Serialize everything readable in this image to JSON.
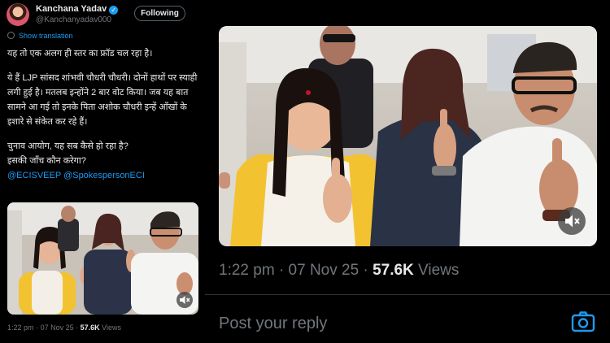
{
  "author": {
    "name": "Kanchana Yadav",
    "handle": "@Kanchanyadav000",
    "verified_icon": "verified-badge-icon",
    "follow_label": "Following"
  },
  "show_translation": "Show translation",
  "tweet": {
    "line1": "यह तो एक अलग ही स्तर का फ्रॉड चल रहा है।",
    "line2": "ये हैं LJP सांसद शांभवी चौधरी चौधरी। दोनों हाथों पर स्याही लगी हुई है। मतलब इन्होंने 2 बार वोट किया। जब यह बात सामने आ गई तो इनके पिता अशोक चौधरी इन्हें आँखों के इशारे से संकेत कर रहे हैं।",
    "line3": "चुनाव आयोग, यह सब कैसे हो रहा है?",
    "line4": "इसकी जाँच कौन करेगा?",
    "mention1": "@ECISVEEP",
    "mention2": "@SpokespersonECI"
  },
  "meta": {
    "time": "1:22 pm",
    "sep": "·",
    "date": "07 Nov 25",
    "views_count": "57.6K",
    "views_label": "Views"
  },
  "reply": {
    "placeholder": "Post your reply"
  },
  "colors": {
    "background": "#000000",
    "accent": "#1d9bf0",
    "muted": "#71767b",
    "text": "#e7e9ea"
  },
  "icons": {
    "mute": "mute-icon",
    "camera": "camera-icon",
    "globe": "globe-icon"
  }
}
